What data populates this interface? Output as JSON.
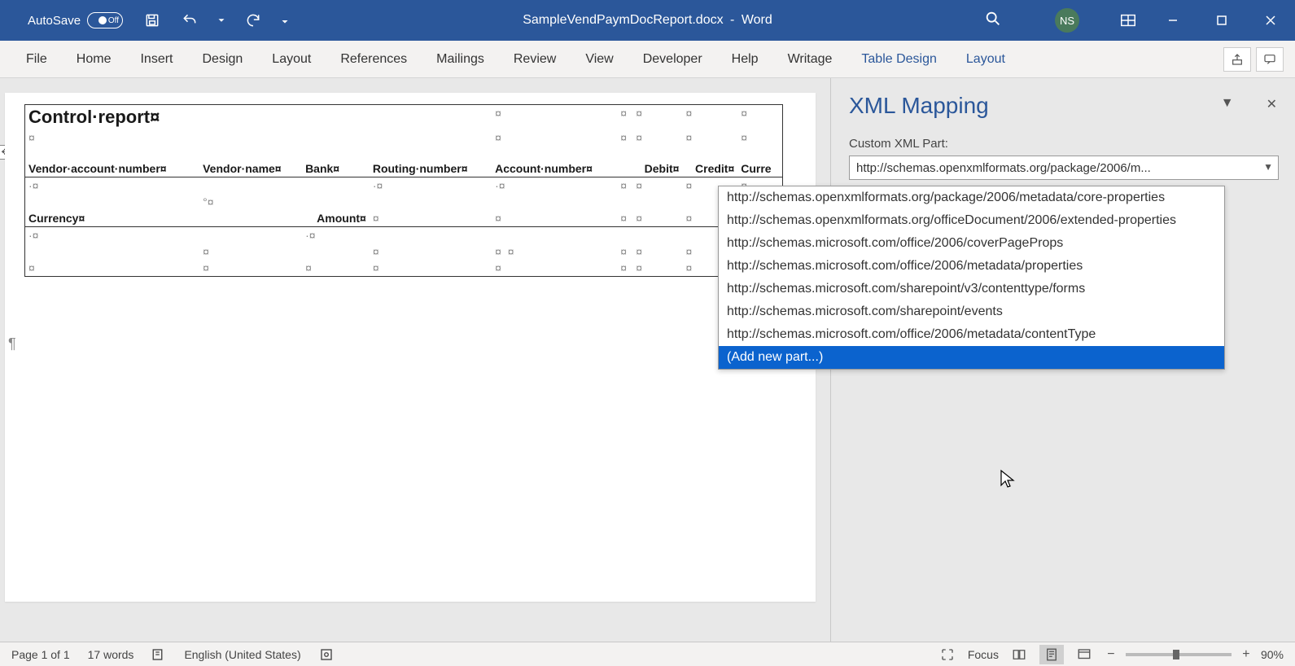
{
  "titlebar": {
    "autosave_label": "AutoSave",
    "autosave_state": "Off",
    "doc_name": "SampleVendPaymDocReport.docx",
    "app_name": "Word",
    "user_initials": "NS"
  },
  "ribbon": {
    "tabs": [
      "File",
      "Home",
      "Insert",
      "Design",
      "Layout",
      "References",
      "Mailings",
      "Review",
      "View",
      "Developer",
      "Help",
      "Writage"
    ],
    "context_tabs": [
      "Table Design",
      "Layout"
    ]
  },
  "document": {
    "title": "Control·report¤",
    "headers_row1": [
      "Vendor·account·number¤",
      "Vendor·name¤",
      "Bank¤",
      "Routing·number¤",
      "Account·number¤",
      "",
      "Debit¤",
      "Credit¤",
      "Curre"
    ],
    "headers_row2": [
      "Currency¤",
      "",
      "Amount¤"
    ]
  },
  "sidepane": {
    "title": "XML Mapping",
    "field_label": "Custom XML Part:",
    "combo_value": "http://schemas.openxmlformats.org/package/2006/m..."
  },
  "dropdown": {
    "items": [
      "http://schemas.openxmlformats.org/package/2006/metadata/core-properties",
      "http://schemas.openxmlformats.org/officeDocument/2006/extended-properties",
      "http://schemas.microsoft.com/office/2006/coverPageProps",
      "http://schemas.microsoft.com/office/2006/metadata/properties",
      "http://schemas.microsoft.com/sharepoint/v3/contenttype/forms",
      "http://schemas.microsoft.com/sharepoint/events",
      "http://schemas.microsoft.com/office/2006/metadata/contentType",
      "(Add new part...)"
    ],
    "selected_index": 7
  },
  "statusbar": {
    "page": "Page 1 of 1",
    "words": "17 words",
    "language": "English (United States)",
    "focus": "Focus",
    "zoom": "90%"
  }
}
